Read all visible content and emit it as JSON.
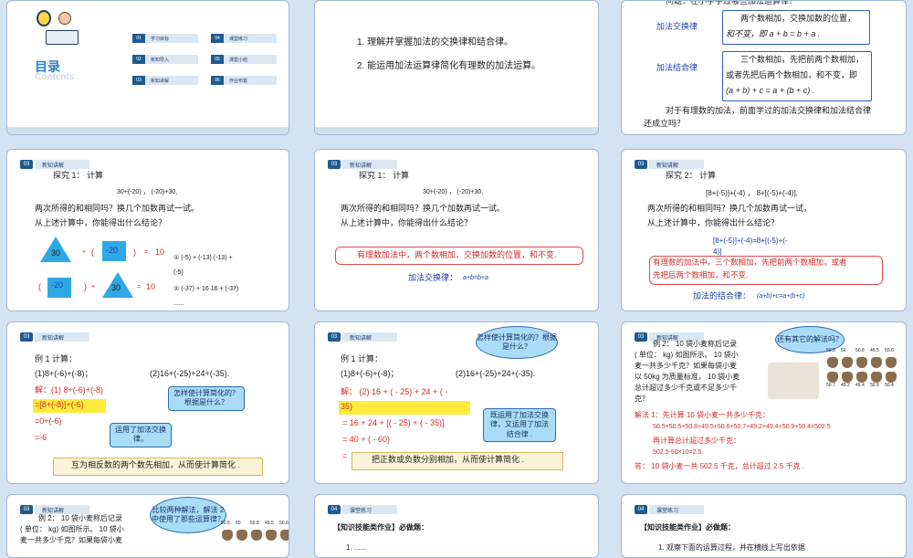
{
  "toc": {
    "title": "目录",
    "subtitle": "Contents",
    "items": [
      {
        "num": "01",
        "label": "学习目标"
      },
      {
        "num": "02",
        "label": "新知导入"
      },
      {
        "num": "03",
        "label": "新知讲解"
      },
      {
        "num": "04",
        "label": "课堂练习"
      },
      {
        "num": "05",
        "label": "课堂小结"
      },
      {
        "num": "06",
        "label": "作业布置"
      }
    ]
  },
  "goals": {
    "line1": "1. 理解并掌握加法的交换律和结合律。",
    "line2": "2. 能运用加法运算律简化有理数的加法运算。"
  },
  "intro": {
    "question": "问题：在小学学过哪些加法运算律？",
    "comm_label": "加法交换律",
    "comm_text1": "两个数相加，交换加数的位置，",
    "comm_text2": "和不变，即  a + b = b + a .",
    "assoc_label": "加法结合律",
    "assoc_text1": "三个数相加，先把前两个数相加，",
    "assoc_text2": "或者先把后两个数相加，和不变，即",
    "assoc_text3": "(a + b) + c = a + (b + c) .",
    "footer1": "对于有理数的加法，前面学过的加法交换律和加法结合律",
    "footer2": "还成立吗？"
  },
  "section_tag": {
    "num": "03",
    "label": "新知讲解"
  },
  "practice_tag": {
    "num": "04",
    "label": "课堂练习"
  },
  "explore1": {
    "title": "探究 1：  计算",
    "expr": "30+(-20) ，  (-20)+30,",
    "line1": "两次所得的和相同吗？换几个加数再试一试。",
    "line2": "从上述计算中，你能得出什么结论？",
    "v30a": "30",
    "vm20a": "-20",
    "v10a": "10",
    "vm20b": "-20",
    "v30b": "30",
    "v10b": "10",
    "plus": "+",
    "lp": "(",
    "rp": ")",
    "eq": "=",
    "ex1": "① (-5) + (-13)      (-13) +",
    "ex1b": "(-5)",
    "ex2": "② (-37) + 16    16 + (-37)",
    "dots": "......"
  },
  "explore1b": {
    "conclusion": "有理数加法中，两个数相加，交换加数的位置，和不变.",
    "law_label": "加法交换律：",
    "law_formula": "a+b=b+a"
  },
  "explore2": {
    "title": "探究 2：  计算",
    "expr": "[8+(-5)]+(-4) ，  8+[(-5)+(-4)],",
    "line1": "两次所得的和相同吗？换几个加数再试一试，",
    "line2": "从上述计算中，你能得出什么结论？",
    "eq_a": "[8+(-5)]+(-4)=8+[(-5)+(-",
    "eq_b": "4)]",
    "conclusion1": "有理数的加法中，三个数相加，先把前两个数相加，或者",
    "conclusion2": "先把后两个数相加，和不变.",
    "law_label": "加法的结合律：",
    "law_formula": "(a+b)+c=a+(b+c)"
  },
  "example1a": {
    "title": "例 1  计算：",
    "q1": "(1)8+(-6)+(-8)；",
    "q2": "(2)16+(-25)+24+(-35).",
    "sol_label": "解：(1)  8+(-6)+(-8)",
    "step1": "=[8+(-8)]+(-6)",
    "step2": "=0+(-6)",
    "step3": "=-6",
    "callout1": "怎样使计算简化的？根据是什么？",
    "callout2": "运用了加法交换律。",
    "summary": "互为相反数的两个数先相加，从而使计算简化 ."
  },
  "example1b": {
    "title": "例 1  计算：",
    "q1": "(1)8+(-6)+(-8)；",
    "q2": "(2)16+(-25)+24+(-35).",
    "sol_a": "解：  (2) 16 + ( - 25) + 24 + ( -",
    "sol_b": "35)",
    "step1": "= 16 + 24 + [( - 25) + ( - 35)]",
    "step2": "= 40 + ( - 60)",
    "step3": "=",
    "cloud": "怎样使计算简化的？根据是什么？",
    "callout": "既运用了加法交换律，又运用了加法结合律 .",
    "summary": "把正数或负数分别相加，从而使计算简化 ."
  },
  "example2": {
    "title": "例 2：  10 袋小麦称后记录",
    "line1": "( 单位：  kg) 如图所示。 10 袋小",
    "line2": "麦一共多少千克？如果每袋小麦",
    "line3": "以 50kg 为质量标准， 10 袋小麦",
    "line4": "总计超过多少千克或不足多少千",
    "line5": "克？",
    "cloud": "还有其它的解法吗？",
    "top_weights": [
      "50.5",
      "50",
      "50.8",
      "49.5",
      "50.6"
    ],
    "bottom_weights": [
      "50.7",
      "49.2",
      "49.4",
      "50.9",
      "50.4"
    ],
    "sol1": "解法 1：先计算 10 袋小麦一共多少千克：",
    "sol1_expr": "50.5+50.5+50.8+49.5+50.6+50.7+49.2+49.4+50.9+50.4=502.5",
    "sol1_b": "再计算总计超过多少千克：",
    "sol1_c": "502.5-50×10=2.5.",
    "answer": "答：  10 袋小麦一共 502.5 千克，总计超过 2.5 千克 ."
  },
  "example2b": {
    "title": "例 2：  10 袋小麦称后记录",
    "line1": "( 单位：  kg) 如图所示。 10 袋小",
    "line2": "麦一共多少千克？如果每袋小麦",
    "cloud": "比较两种解法，解法 2 中使用了那些运算律？",
    "top_weights": [
      "50.5",
      "50",
      "50.8",
      "49.5",
      "50.6"
    ]
  },
  "practice1": {
    "heading": "【知识技能类作业】必做题：",
    "line": "1. ......"
  },
  "practice2": {
    "heading": "【知识技能类作业】必做题：",
    "line": "1. 观察下面的运算过程，并在横线上写出依据"
  }
}
